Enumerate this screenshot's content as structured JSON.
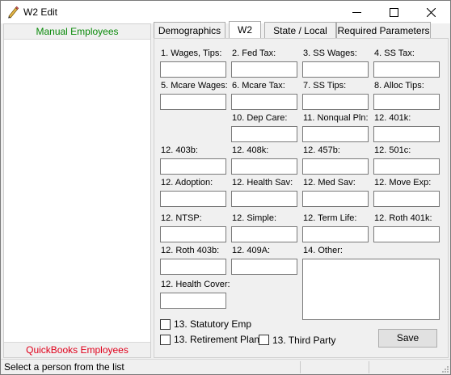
{
  "window": {
    "title": "W2 Edit",
    "minimize_icon": "minimize-icon",
    "maximize_icon": "maximize-icon",
    "close_icon": "close-icon"
  },
  "left_pane": {
    "header": "Manual Employees",
    "header_color": "#0a8a0a",
    "footer": "QuickBooks Employees",
    "footer_color": "#e0001b",
    "items": []
  },
  "tabs": [
    {
      "label": "Demographics",
      "active": false
    },
    {
      "label": "W2",
      "active": true
    },
    {
      "label": "State / Local",
      "active": false
    },
    {
      "label": "Required Parameters",
      "active": false
    }
  ],
  "fields": {
    "wages_tips": {
      "label": "1. Wages, Tips:",
      "value": ""
    },
    "fed_tax": {
      "label": "2. Fed Tax:",
      "value": ""
    },
    "ss_wages": {
      "label": "3. SS Wages:",
      "value": ""
    },
    "ss_tax": {
      "label": "4. SS Tax:",
      "value": ""
    },
    "mcare_wages": {
      "label": "5. Mcare Wages:",
      "value": ""
    },
    "mcare_tax": {
      "label": "6. Mcare Tax:",
      "value": ""
    },
    "ss_tips": {
      "label": "7. SS Tips:",
      "value": ""
    },
    "alloc_tips": {
      "label": "8. Alloc Tips:",
      "value": ""
    },
    "dep_care": {
      "label": "10. Dep Care:",
      "value": ""
    },
    "nonqual_pln": {
      "label": "11. Nonqual Pln:",
      "value": ""
    },
    "c401k": {
      "label": "12. 401k:",
      "value": ""
    },
    "c403b": {
      "label": "12. 403b:",
      "value": ""
    },
    "c408k": {
      "label": "12. 408k:",
      "value": ""
    },
    "c457b": {
      "label": "12. 457b:",
      "value": ""
    },
    "c501c": {
      "label": "12. 501c:",
      "value": ""
    },
    "adoption": {
      "label": "12. Adoption:",
      "value": ""
    },
    "health_sav": {
      "label": "12. Health Sav:",
      "value": ""
    },
    "med_sav": {
      "label": "12. Med Sav:",
      "value": ""
    },
    "move_exp": {
      "label": "12. Move Exp:",
      "value": ""
    },
    "ntsp": {
      "label": "12. NTSP:",
      "value": ""
    },
    "simple": {
      "label": "12. Simple:",
      "value": ""
    },
    "term_life": {
      "label": "12. Term Life:",
      "value": ""
    },
    "roth_401k": {
      "label": "12. Roth 401k:",
      "value": ""
    },
    "roth_403b": {
      "label": "12. Roth 403b:",
      "value": ""
    },
    "c409a": {
      "label": "12. 409A:",
      "value": ""
    },
    "health_cover": {
      "label": "12. Health Cover:",
      "value": ""
    },
    "other": {
      "label": "14. Other:",
      "value": ""
    }
  },
  "checkboxes": {
    "statutory_emp": {
      "label": "13. Statutory Emp",
      "checked": false
    },
    "retirement_plan": {
      "label": "13. Retirement Plan",
      "checked": false
    },
    "third_party": {
      "label": "13. Third Party",
      "checked": false
    }
  },
  "save_button": "Save",
  "status": {
    "text": "Select a person from the list",
    "grip_icon": "resize-grip-icon"
  }
}
